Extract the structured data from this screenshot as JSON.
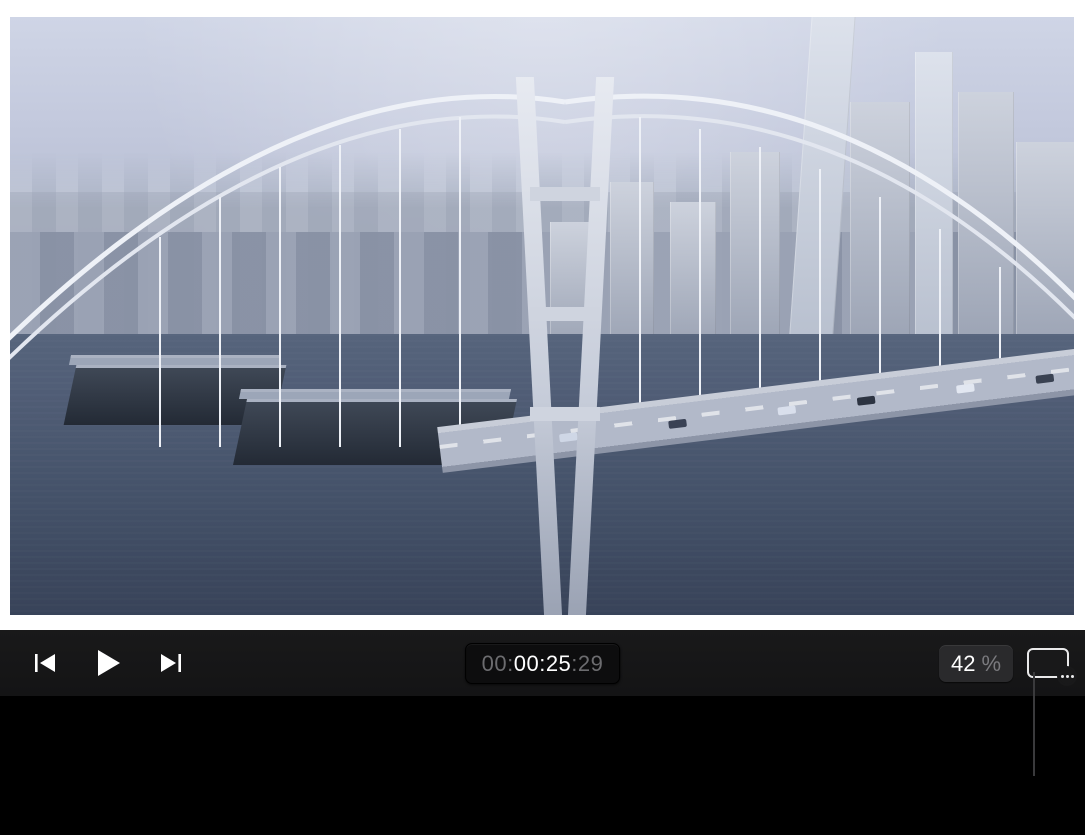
{
  "playback": {
    "timecode": {
      "hh": "00",
      "mm": "00",
      "ss": "25",
      "ff": "29"
    },
    "scale_value": "42",
    "scale_unit": "%"
  },
  "icons": {
    "previous": "skip-back-icon",
    "play": "play-icon",
    "next": "skip-forward-icon",
    "view": "view-options-icon"
  }
}
